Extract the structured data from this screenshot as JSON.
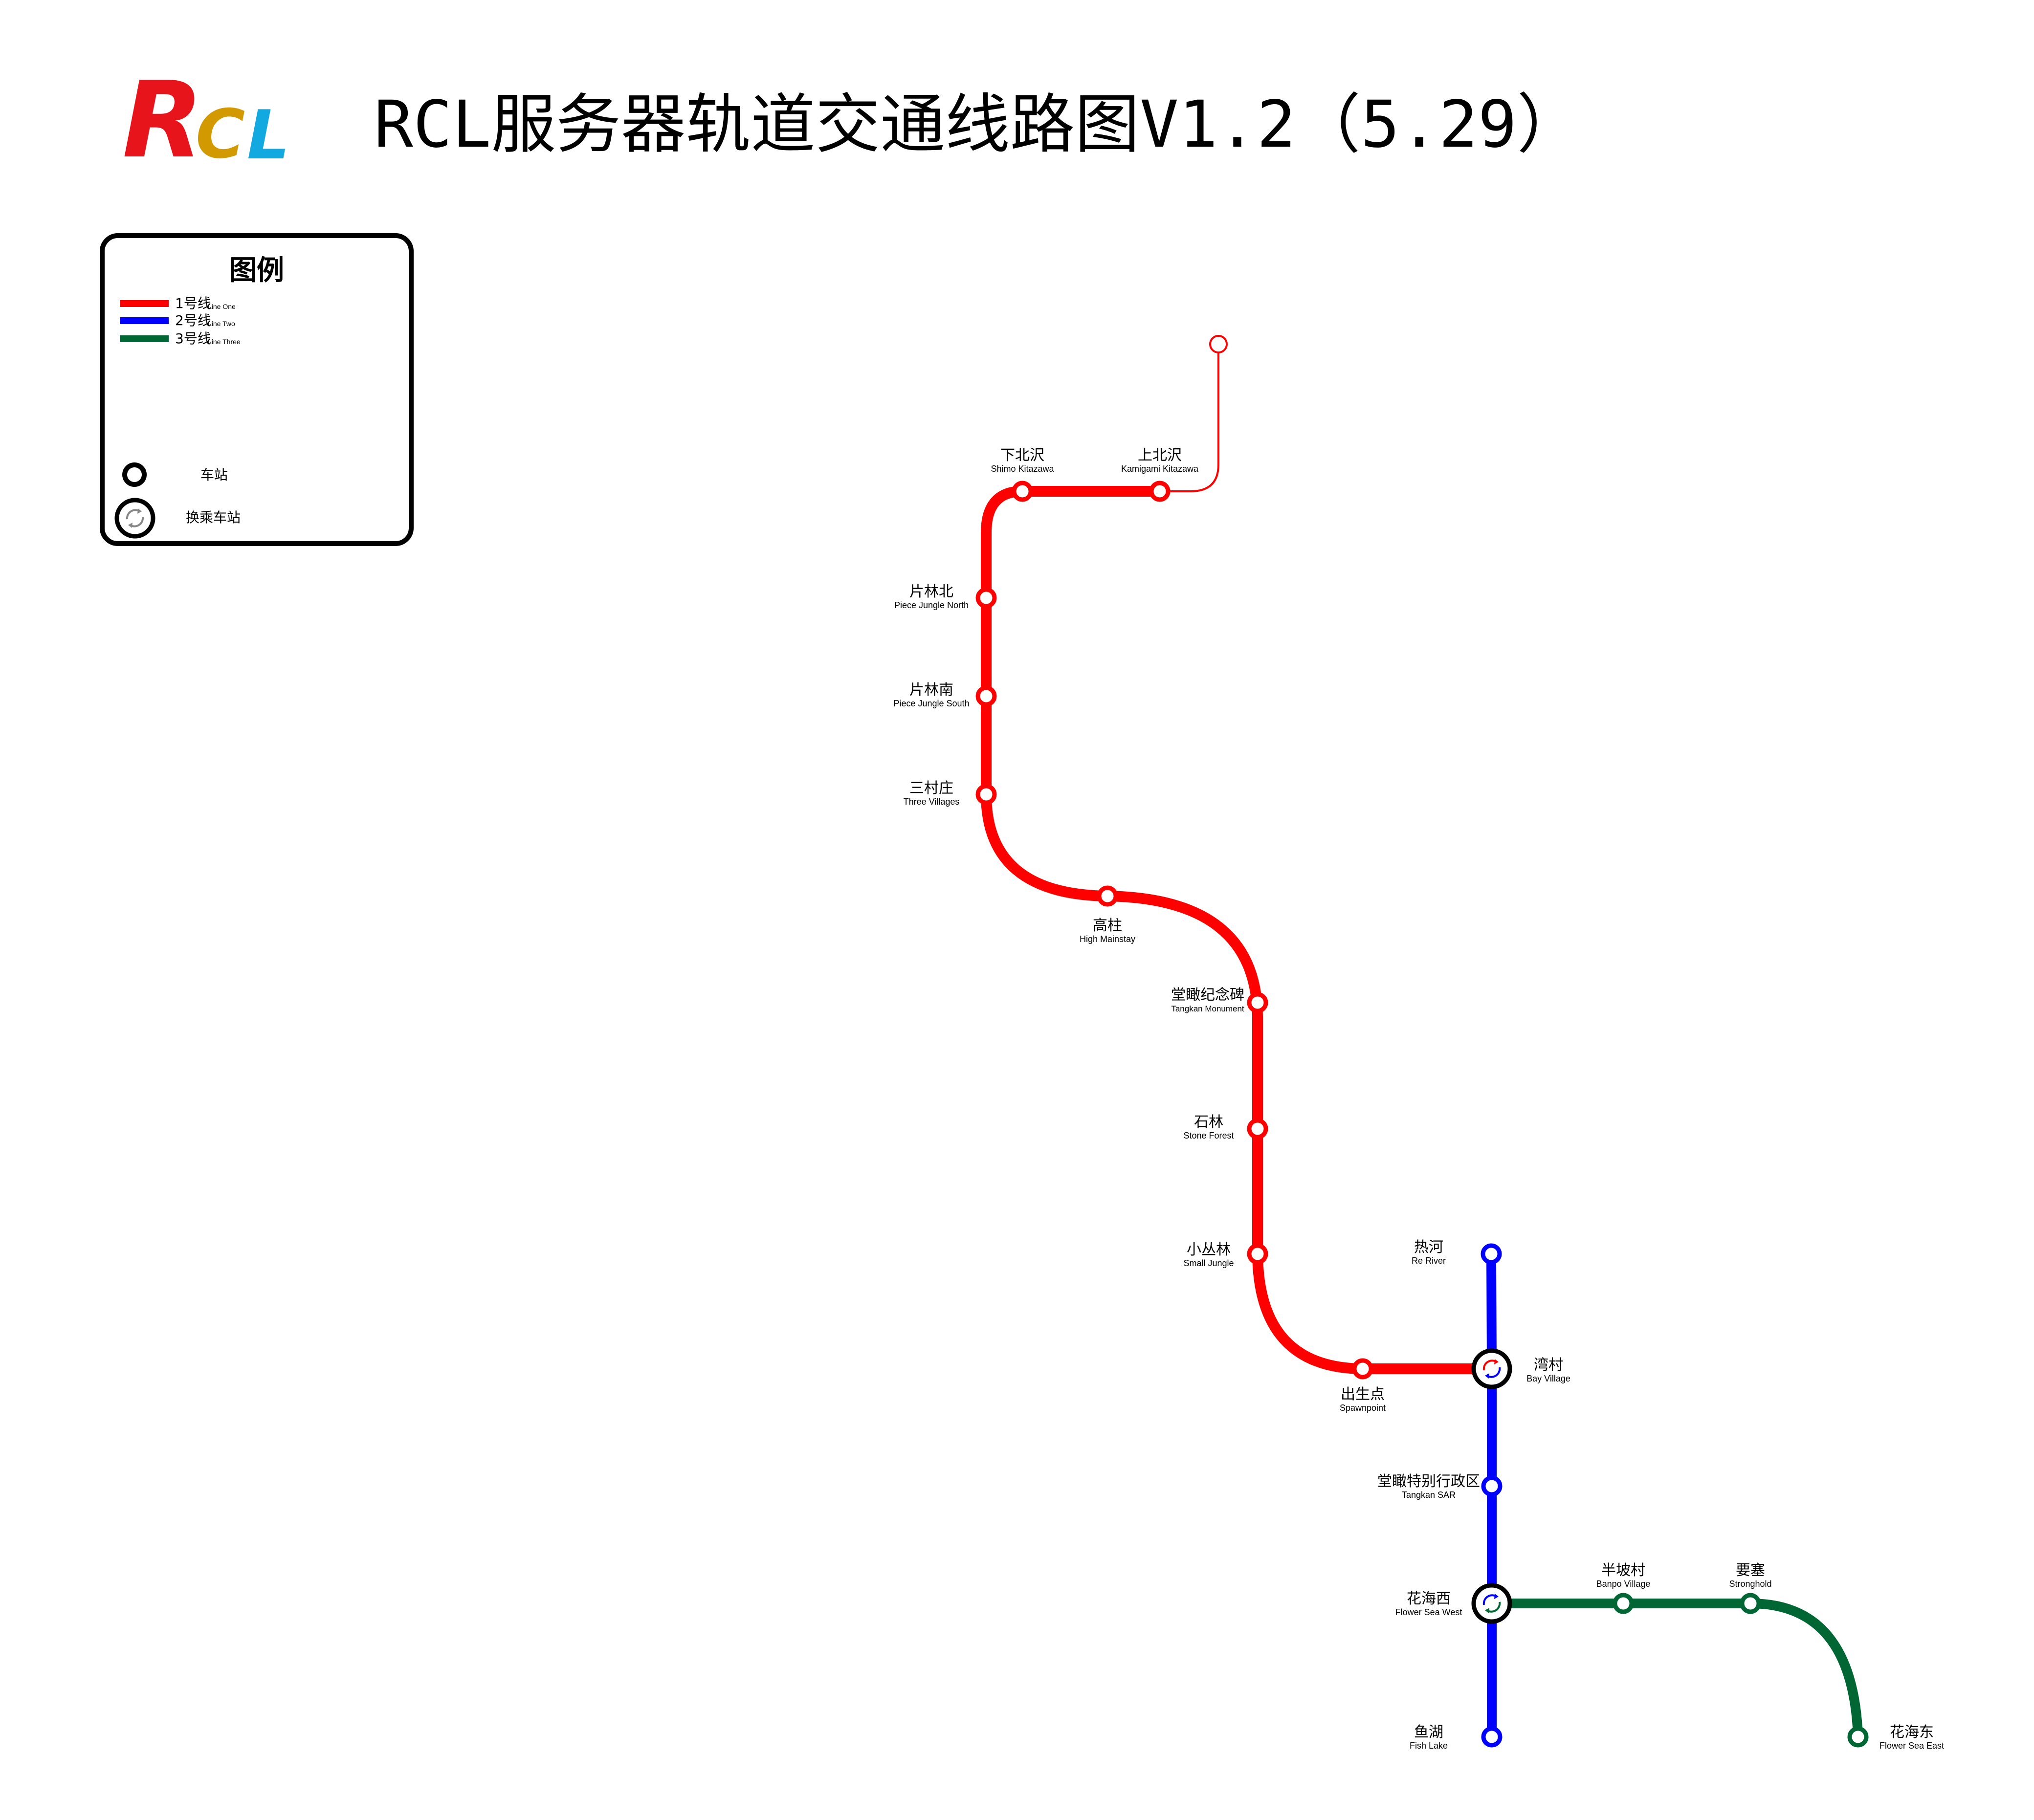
{
  "header": {
    "logo": [
      {
        "letter": "R",
        "color": "#e8141c"
      },
      {
        "letter": "C",
        "color": "#d29a00"
      },
      {
        "letter": "L",
        "color": "#12a8e0"
      }
    ],
    "title": "RCL服务器轨道交通线路图V1.2（5.29）"
  },
  "legend": {
    "title": "图例",
    "lines": [
      {
        "zh": "1号线",
        "en": "Line One",
        "color": "#ff0000"
      },
      {
        "zh": "2号线",
        "en": "Line Two",
        "color": "#0000ff"
      },
      {
        "zh": "3号线",
        "en": "Line Three",
        "color": "#006633"
      }
    ],
    "station_label": "车站",
    "transfer_label": "换乘车站"
  },
  "lines": {
    "line1": {
      "color": "#ff0000"
    },
    "line2": {
      "color": "#0000ff"
    },
    "line3": {
      "color": "#006633"
    }
  },
  "stations": {
    "xiabeize": {
      "zh": "下北沢",
      "en": "Shimo Kitazawa"
    },
    "shangbeize": {
      "zh": "上北沢",
      "en": "Kamigami Kitazawa"
    },
    "pianlinbei": {
      "zh": "片林北",
      "en": "Piece Jungle North"
    },
    "pianlinnan": {
      "zh": "片林南",
      "en": "Piece Jungle South"
    },
    "sancunzhuang": {
      "zh": "三村庄",
      "en": "Three Villages"
    },
    "gaozhu": {
      "zh": "高柱",
      "en": "High Mainstay"
    },
    "tangkanmonument": {
      "zh": "堂瞰纪念碑",
      "en": "Tangkan Monument"
    },
    "shilin": {
      "zh": "石林",
      "en": "Stone Forest"
    },
    "xiaocongln": {
      "zh": "小丛林",
      "en": "Small Jungle"
    },
    "chushengdian": {
      "zh": "出生点",
      "en": "Spawnpoint"
    },
    "wancun": {
      "zh": "湾村",
      "en": "Bay Village"
    },
    "rehe": {
      "zh": "热河",
      "en": "Re River"
    },
    "tangkansar": {
      "zh": "堂瞰特别行政区",
      "en": "Tangkan SAR"
    },
    "huahaixi": {
      "zh": "花海西",
      "en": "Flower Sea West"
    },
    "yuhu": {
      "zh": "鱼湖",
      "en": "Fish Lake"
    },
    "banpocun": {
      "zh": "半坡村",
      "en": "Banpo Village"
    },
    "yaosai": {
      "zh": "要塞",
      "en": "Stronghold"
    },
    "huahaidong": {
      "zh": "花海东",
      "en": "Flower Sea East"
    }
  }
}
